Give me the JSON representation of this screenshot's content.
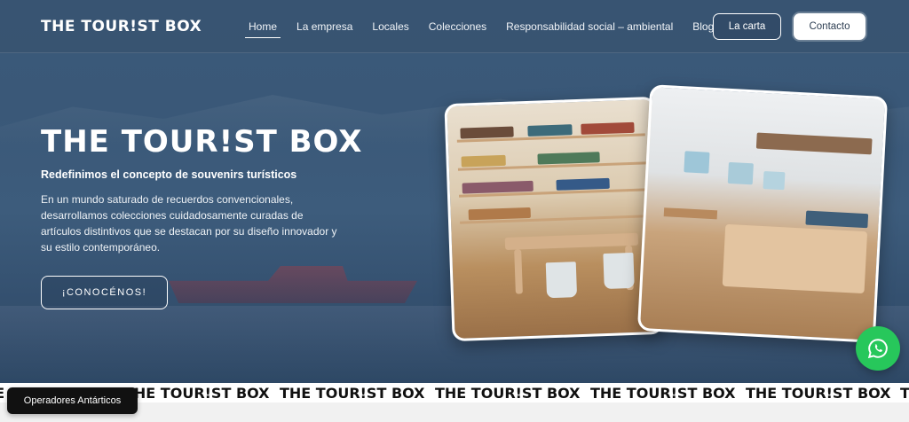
{
  "brand": {
    "logo": "THE TOUR!ST BOX"
  },
  "nav": {
    "items": [
      "Home",
      "La empresa",
      "Locales",
      "Colecciones",
      "Responsabilidad social – ambiental",
      "Blog"
    ],
    "carta_label": "La carta",
    "contact_label": "Contacto"
  },
  "hero": {
    "title": "THE TOUR!ST BOX",
    "subtitle": "Redefinimos el concepto de souvenirs turísticos",
    "description": "En un mundo saturado de recuerdos convencionales, desarrollamos colecciones cuidadosamente curadas de artículos distintivos que se destacan por su diseño innovador y su estilo contemporáneo.",
    "cta_label": "¡CONOCÉNOS!"
  },
  "marquee": {
    "text": "THE TOUR!ST BOX"
  },
  "chip": {
    "label": "Operadores Antárticos"
  },
  "colors": {
    "accent_whatsapp": "#27c75b",
    "hero_bg": "#3b5a7a"
  },
  "icons": {
    "whatsapp": "whatsapp-icon"
  }
}
